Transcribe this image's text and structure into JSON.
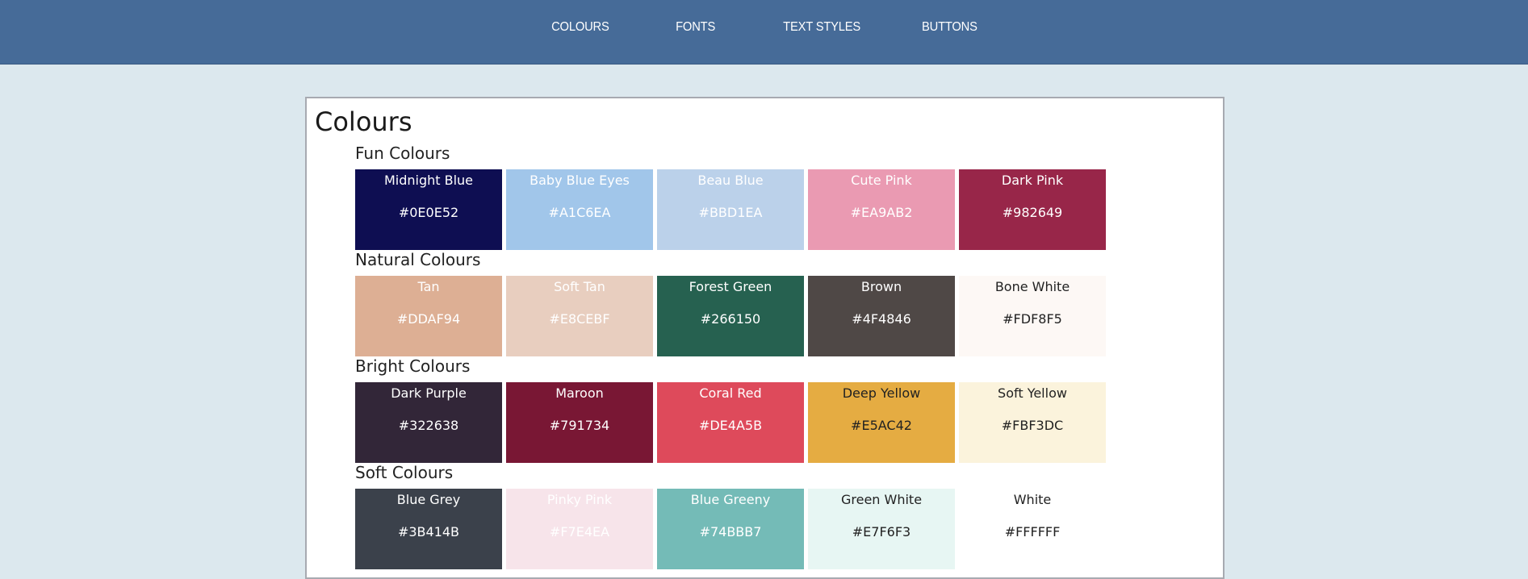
{
  "nav": {
    "items": [
      {
        "label": "COLOURS"
      },
      {
        "label": "FONTS"
      },
      {
        "label": "TEXT STYLES"
      },
      {
        "label": "BUTTONS"
      }
    ]
  },
  "main": {
    "title": "Colours",
    "groups": [
      {
        "title": "Fun Colours",
        "swatches": [
          {
            "name": "Midnight Blue",
            "hex": "#0E0E52",
            "bg": "#0E0E52",
            "text_color": "#ffffff"
          },
          {
            "name": "Baby Blue Eyes",
            "hex": "#A1C6EA",
            "bg": "#A1C6EA",
            "text_color": "#ffffff"
          },
          {
            "name": "Beau Blue",
            "hex": "#BBD1EA",
            "bg": "#BBD1EA",
            "text_color": "#ffffff"
          },
          {
            "name": "Cute Pink",
            "hex": "#EA9AB2",
            "bg": "#EA9AB2",
            "text_color": "#ffffff"
          },
          {
            "name": "Dark Pink",
            "hex": "#982649",
            "bg": "#982649",
            "text_color": "#ffffff"
          }
        ]
      },
      {
        "title": "Natural Colours",
        "swatches": [
          {
            "name": "Tan",
            "hex": "#DDAF94",
            "bg": "#DDAF94",
            "text_color": "#ffffff"
          },
          {
            "name": "Soft Tan",
            "hex": "#E8CEBF",
            "bg": "#E8CEBF",
            "text_color": "#ffffff"
          },
          {
            "name": "Forest Green",
            "hex": "#266150",
            "bg": "#266150",
            "text_color": "#ffffff"
          },
          {
            "name": "Brown",
            "hex": "#4F4846",
            "bg": "#4F4846",
            "text_color": "#ffffff"
          },
          {
            "name": "Bone White",
            "hex": "#FDF8F5",
            "bg": "#FDF8F5",
            "text_color": "#222222"
          }
        ]
      },
      {
        "title": "Bright Colours",
        "swatches": [
          {
            "name": "Dark Purple",
            "hex": "#322638",
            "bg": "#322638",
            "text_color": "#ffffff"
          },
          {
            "name": "Maroon",
            "hex": "#791734",
            "bg": "#791734",
            "text_color": "#ffffff"
          },
          {
            "name": "Coral Red",
            "hex": "#DE4A5B",
            "bg": "#DE4A5B",
            "text_color": "#ffffff"
          },
          {
            "name": "Deep Yellow",
            "hex": "#E5AC42",
            "bg": "#E5AC42",
            "text_color": "#222222"
          },
          {
            "name": "Soft Yellow",
            "hex": "#FBF3DC",
            "bg": "#FBF3DC",
            "text_color": "#222222"
          }
        ]
      },
      {
        "title": "Soft Colours",
        "swatches": [
          {
            "name": "Blue Grey",
            "hex": "#3B414B",
            "bg": "#3B414B",
            "text_color": "#ffffff"
          },
          {
            "name": "Pinky Pink",
            "hex": "#F7E4EA",
            "bg": "#F7E4EA",
            "text_color": "#ffffff"
          },
          {
            "name": "Blue Greeny",
            "hex": "#74BBB7",
            "bg": "#74BBB7",
            "text_color": "#ffffff"
          },
          {
            "name": "Green White",
            "hex": "#E7F6F3",
            "bg": "#E7F6F3",
            "text_color": "#222222"
          },
          {
            "name": "White",
            "hex": "#FFFFFF",
            "bg": "#FFFFFF",
            "text_color": "#222222"
          }
        ]
      }
    ]
  }
}
